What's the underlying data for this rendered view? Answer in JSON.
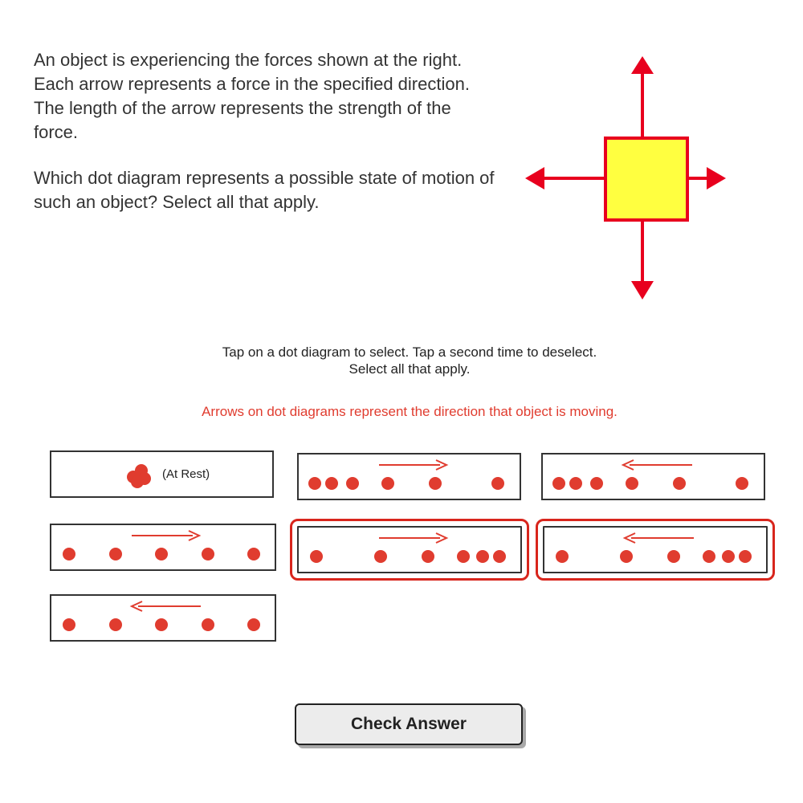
{
  "question": {
    "paragraph_1": "An object is experiencing the forces shown at the right. Each arrow represents a force in the specified direction. The length of the arrow represents the strength of the force.",
    "paragraph_2": "Which dot diagram represents a possible state of motion of such an object? Select all that apply."
  },
  "instructions": {
    "line_1": "Tap on a dot diagram to select. Tap a second time to deselect.",
    "line_2": "Select all that apply.",
    "note": "Arrows on dot diagrams represent the direction that object is moving."
  },
  "colors": {
    "dot": "#e03c2f",
    "arrow": "#e03c2f",
    "selection": "#d8251c",
    "force_arrow": "#e8001e",
    "box_fill": "#ffff40"
  },
  "force_diagram": {
    "forces": [
      {
        "direction": "up",
        "strength": "long"
      },
      {
        "direction": "down",
        "strength": "long"
      },
      {
        "direction": "left",
        "strength": "medium"
      },
      {
        "direction": "right",
        "strength": "short"
      }
    ]
  },
  "dot_diagrams": [
    {
      "id": "at-rest",
      "label": "(At Rest)",
      "direction": "none",
      "pattern": "stacked",
      "selected": false
    },
    {
      "id": "right-speeding-up",
      "direction": "right",
      "pattern": "increasing",
      "selected": false
    },
    {
      "id": "left-slowing-down",
      "direction": "left",
      "pattern": "increasing",
      "selected": false
    },
    {
      "id": "right-constant",
      "direction": "right",
      "pattern": "constant",
      "selected": false
    },
    {
      "id": "right-slowing-down",
      "direction": "right",
      "pattern": "decreasing",
      "selected": true
    },
    {
      "id": "left-speeding-up",
      "direction": "left",
      "pattern": "decreasing",
      "selected": true
    },
    {
      "id": "left-constant",
      "direction": "left",
      "pattern": "constant",
      "selected": false
    }
  ],
  "button": {
    "label": "Check Answer"
  }
}
